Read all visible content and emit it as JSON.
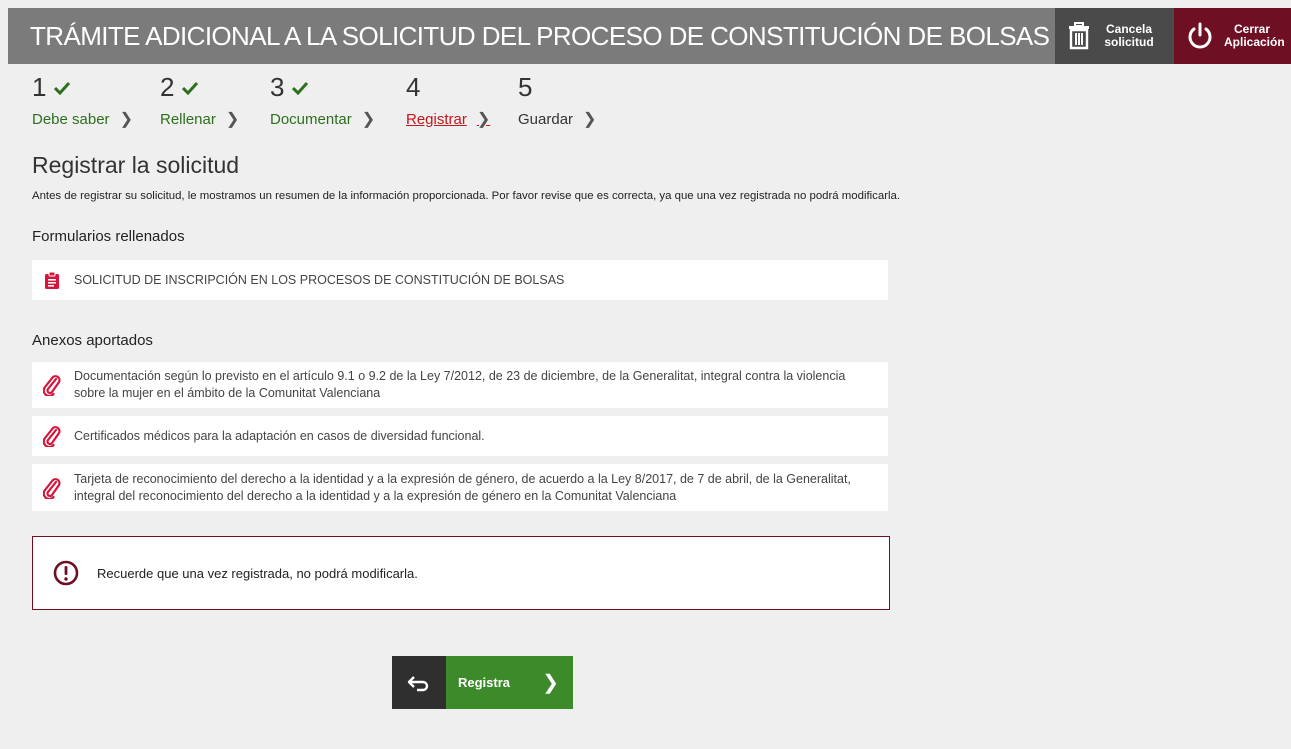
{
  "header": {
    "title": "TRÁMITE ADICIONAL A LA SOLICITUD DEL PROCESO DE CONSTITUCIÓN DE BOLSAS",
    "cancel_label": "Cancela\nsolicitud",
    "cancel_icon": "trash-icon",
    "close_label": "Cerrar\nAplicación",
    "close_icon": "power-icon"
  },
  "steps": [
    {
      "number": "1",
      "label": "Debe saber",
      "state": "done"
    },
    {
      "number": "2",
      "label": "Rellenar",
      "state": "done"
    },
    {
      "number": "3",
      "label": "Documentar",
      "state": "done"
    },
    {
      "number": "4",
      "label": "Registrar",
      "state": "current"
    },
    {
      "number": "5",
      "label": "Guardar",
      "state": "pending"
    }
  ],
  "main": {
    "title": "Registrar la solicitud",
    "intro": "Antes de registrar su solicitud, le mostramos un resumen de la información proporcionada. Por favor revise que es correcta, ya que una vez registrada no podrá modificarla.",
    "forms_heading": "Formularios rellenados",
    "forms": [
      {
        "label": "SOLICITUD DE INSCRIPCIÓN EN LOS PROCESOS DE CONSTITUCIÓN DE BOLSAS",
        "icon": "clipboard-icon"
      }
    ],
    "annexes_heading": "Anexos aportados",
    "annexes": [
      {
        "label": "Documentación según lo previsto en el artículo 9.1 o 9.2 de la Ley 7/2012, de 23 de diciembre, de la Generalitat, integral contra la violencia sobre la mujer en el ámbito de la Comunitat Valenciana",
        "icon": "paperclip-icon"
      },
      {
        "label": "Certificados médicos para la adaptación en casos de diversidad funcional.",
        "icon": "paperclip-icon"
      },
      {
        "label": "Tarjeta de reconocimiento del derecho a la identidad y a la expresión de género, de acuerdo a la Ley 8/2017, de 7 de abril, de la Generalitat, integral del reconocimiento del derecho a la identidad y a la expresión de género en la Comunitat Valenciana",
        "icon": "paperclip-icon"
      }
    ],
    "alert": "Recuerde que una vez registrada, no podrá modificarla.",
    "alert_icon": "exclamation-circle-icon"
  },
  "actions": {
    "back_icon": "return-arrow-icon",
    "register_label": "Registra",
    "register_icon": "chevron-right-icon"
  },
  "colors": {
    "topbar": "#7b7b7b",
    "cancel_bg": "#4a4a4a",
    "close_bg": "#6e0f23",
    "done_green": "#2e6f1e",
    "current_red": "#c4161c",
    "register_green": "#3d8a2a",
    "icon_red": "#d7143c"
  }
}
